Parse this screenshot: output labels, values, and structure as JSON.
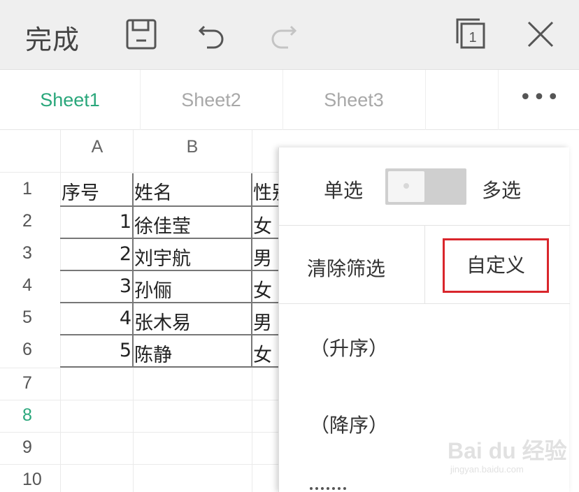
{
  "toolbar": {
    "done_label": "完成",
    "icons": [
      "save-icon",
      "undo-icon",
      "redo-icon",
      "sheets-icon",
      "close-icon"
    ],
    "sheets_count": "1"
  },
  "tabs": {
    "items": [
      {
        "label": "Sheet1",
        "active": true
      },
      {
        "label": "Sheet2",
        "active": false
      },
      {
        "label": "Sheet3",
        "active": false
      }
    ],
    "more_label": "•••",
    "accent_color": "#2aa77b"
  },
  "grid": {
    "columns": [
      "A",
      "B"
    ],
    "rows": [
      "1",
      "2",
      "3",
      "4",
      "5",
      "6",
      "7",
      "8",
      "9",
      "10"
    ],
    "highlighted_row": "8",
    "header": [
      "序号",
      "姓名",
      "性别"
    ],
    "data": [
      [
        "1",
        "徐佳莹",
        "女"
      ],
      [
        "2",
        "刘宇航",
        "男"
      ],
      [
        "3",
        "孙俪",
        "女"
      ],
      [
        "4",
        "张木易",
        "男"
      ],
      [
        "5",
        "陈静",
        "女"
      ]
    ]
  },
  "filter_popup": {
    "single_label": "单选",
    "multi_label": "多选",
    "clear_label": "清除筛选",
    "custom_label": "自定义",
    "asc_label": "（升序）",
    "desc_label": "（降序）",
    "highlight_color": "#d9262c"
  },
  "watermark": {
    "text": "Bai du 经验",
    "sub": "jingyan.baidu.com"
  }
}
